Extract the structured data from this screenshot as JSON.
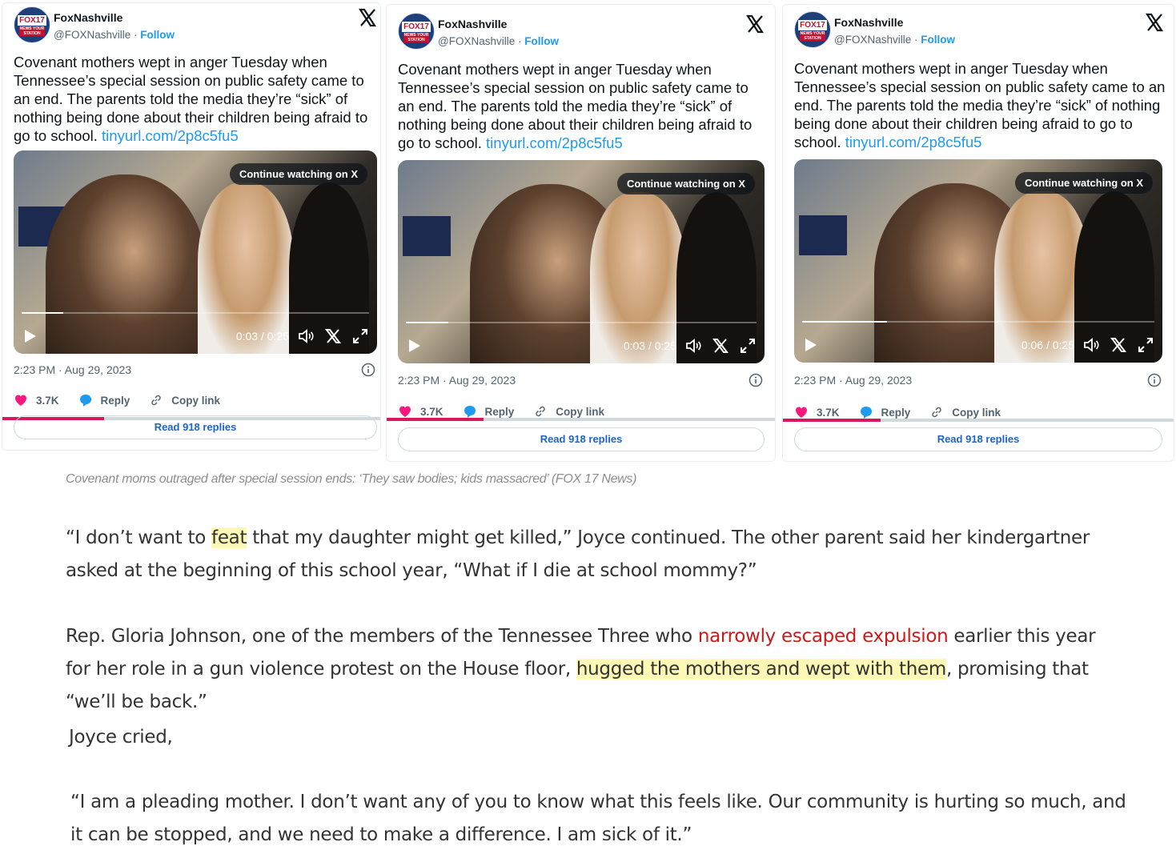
{
  "tweets": [
    {
      "name": "FoxNashville",
      "handle": "@FOXNashville",
      "sep": " · ",
      "follow": "Follow",
      "avatar_logo_top": "FOX17",
      "avatar_logo_bottom": "NEWS YOUR STATION",
      "text": "Covenant mothers wept in anger Tuesday when Tennessee’s special session on public safety came to an end. The parents told the media they’re “sick” of nothing being done about their children being afraid to go to school. ",
      "link": "tinyurl.com/2p8c5fu5",
      "video_pill": "Continue watching on X",
      "video_time": "0:03 / 0:25",
      "video_progress_fraction": 0.12,
      "date": "2:23 PM · Aug 29, 2023",
      "likes": "3.7K",
      "reply": "Reply",
      "copy_link": "Copy link",
      "read_replies": "Read 918 replies",
      "read_fraction": 0.27
    },
    {
      "name": "FoxNashville",
      "handle": "@FOXNashville",
      "sep": " · ",
      "follow": "Follow",
      "avatar_logo_top": "FOX17",
      "avatar_logo_bottom": "NEWS YOUR STATION",
      "text": "Covenant mothers wept in anger Tuesday when Tennessee’s special session on public safety came to an end. The parents told the media they’re “sick” of nothing being done about their children being afraid to go to school. ",
      "link": "tinyurl.com/2p8c5fu5",
      "video_pill": "Continue watching on X",
      "video_time": "0:03 / 0:25",
      "video_progress_fraction": 0.12,
      "date": "2:23 PM · Aug 29, 2023",
      "likes": "3.7K",
      "reply": "Reply",
      "copy_link": "Copy link",
      "read_replies": "Read 918 replies",
      "read_fraction": 0.25
    },
    {
      "name": "FoxNashville",
      "handle": "@FOXNashville",
      "sep": " · ",
      "follow": "Follow",
      "avatar_logo_top": "FOX17",
      "avatar_logo_bottom": "NEWS YOUR STATION",
      "text": "Covenant mothers wept in anger Tuesday when Tennessee’s special session on public safety came to an end. The parents told the media they’re “sick” of nothing being done about their children being afraid to go to school. ",
      "link": "tinyurl.com/2p8c5fu5",
      "video_pill": "Continue watching on X",
      "video_time": "0:06 / 0:25",
      "video_progress_fraction": 0.24,
      "date": "2:23 PM · Aug 29, 2023",
      "likes": "3.7K",
      "reply": "Reply",
      "copy_link": "Copy link",
      "read_replies": "Read 918 replies",
      "read_fraction": 0.25
    }
  ],
  "article": {
    "caption": "Covenant moms outraged after special session ends: ‘They saw bodies; kids massacred’ (FOX 17 News)",
    "p1_a": "“I don’t want to ",
    "p1_hl": "feat",
    "p1_b": " that my daughter might get killed,” Joyce continued. The other parent said her kindergartner",
    "p1_line2": "asked at the beginning of this school year, “What if I die at school mommy?”",
    "p2_a": "Rep. Gloria Johnson, one of the members of the Tennessee Three who ",
    "p2_link": "narrowly escaped expulsion",
    "p2_b": " earlier this year",
    "p2_line2_a": "for her role in a gun violence protest on the House floor, ",
    "p2_hl": "hugged the mothers and wept with them",
    "p2_line2_b": ", promising that",
    "p2_line3": "“we’ll be back.”",
    "p3": "Joyce cried,",
    "p4_line1": "“I am a pleading mother. I don’t want any of you to know what this feels like. Our community is hurting so much, and",
    "p4_line2": "it can be stopped, and we need to make a difference. I am sick of it.”"
  },
  "colors": {
    "link_blue": "#1d9bf0",
    "heart_pink": "#f91880",
    "highlight_yellow": "#fdf8b5",
    "link_red": "#cc1a1a"
  }
}
